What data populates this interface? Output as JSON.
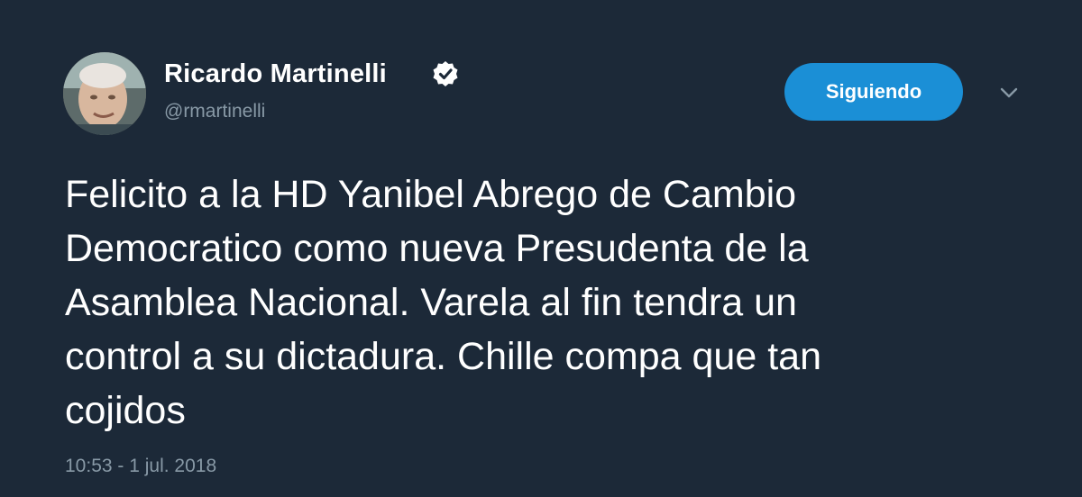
{
  "author": {
    "display_name": "Ricardo Martinelli",
    "handle": "@rmartinelli",
    "verified": true
  },
  "follow_button": {
    "label": "Siguiendo"
  },
  "tweet": {
    "text": "Felicito a la HD Yanibel Abrego de Cambio\nDemocratico como nueva Presudenta de la\nAsamblea Nacional. Varela al fin tendra un\ncontrol a su dictadura. Chille compa que tan\ncojidos",
    "timestamp": "10:53 - 1 jul. 2018"
  },
  "icons": {
    "verified": "verified-badge-icon",
    "menu": "chevron-down-icon"
  },
  "colors": {
    "background": "#1c2938",
    "accent": "#1b8fd6",
    "secondary_text": "#8899a6",
    "primary_text": "#ffffff"
  }
}
